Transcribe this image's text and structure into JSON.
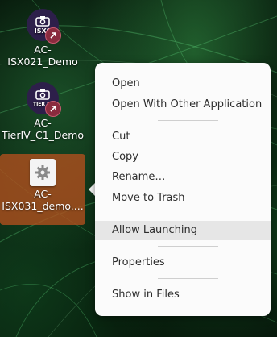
{
  "desktop": {
    "icons": [
      {
        "label_line1": "AC-",
        "label_line2": "ISX021_Demo",
        "badge": "ISX0",
        "icon": "camera-icon"
      },
      {
        "label_line1": "AC-",
        "label_line2": "TierIV_C1_Demo",
        "badge": "TIER IV",
        "icon": "camera-icon"
      },
      {
        "label_line1": "AC-",
        "label_line2": "ISX031_demo....",
        "icon": "gear-icon",
        "selected": true
      }
    ]
  },
  "context_menu": {
    "items": [
      "Open",
      "Open With Other Application",
      "Cut",
      "Copy",
      "Rename…",
      "Move to Trash",
      "Allow Launching",
      "Properties",
      "Show in Files"
    ],
    "highlighted": "Allow Launching"
  },
  "colors": {
    "selection": "#b4501e",
    "menu_bg": "#fbfbfb",
    "menu_highlight": "#e6e6e6",
    "app_circle": "#2d1f4a",
    "link_badge": "#8a2b3e"
  }
}
